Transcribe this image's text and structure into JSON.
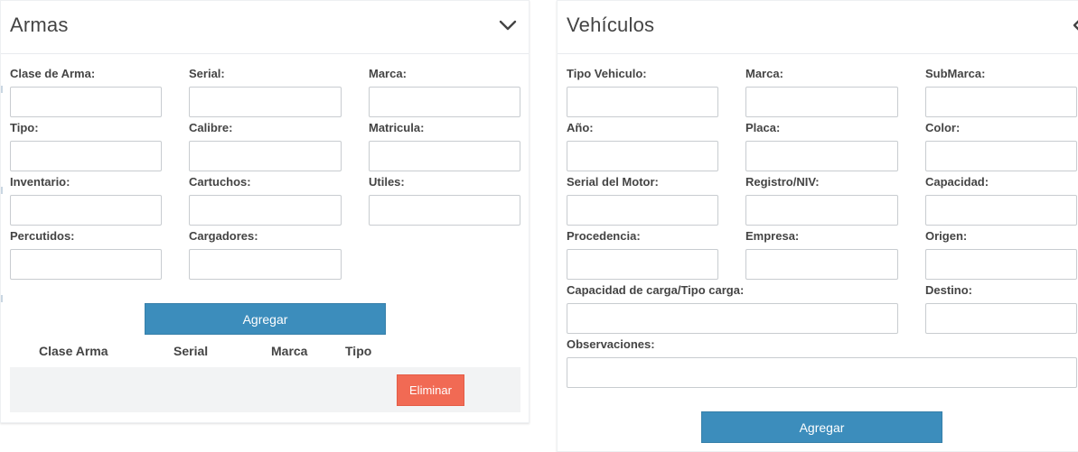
{
  "armas": {
    "title": "Armas",
    "toggle_icon": "chevron-down-icon",
    "fields": {
      "clase_arma": "Clase de Arma:",
      "serial": "Serial:",
      "marca": "Marca:",
      "tipo": "Tipo:",
      "calibre": "Calibre:",
      "matricula": "Matricula:",
      "inventario": "Inventario:",
      "cartuchos": "Cartuchos:",
      "utiles": "Utiles:",
      "percutidos": "Percutidos:",
      "cargadores": "Cargadores:"
    },
    "add_label": "Agregar",
    "table": {
      "headers": [
        "Clase Arma",
        "Serial",
        "Marca",
        "Tipo"
      ],
      "delete_label": "Eliminar"
    }
  },
  "vehiculos": {
    "title": "Vehículos",
    "toggle_icon": "chevron-left-icon",
    "fields": {
      "tipo_vehiculo": "Tipo Vehiculo:",
      "marca": "Marca:",
      "submarca": "SubMarca:",
      "anio": "Año:",
      "placa": "Placa:",
      "color": "Color:",
      "serial_motor": "Serial del Motor:",
      "registro_niv": "Registro/NIV:",
      "capacidad": "Capacidad:",
      "procedencia": "Procedencia:",
      "empresa": "Empresa:",
      "origen": "Origen:",
      "capacidad_carga": "Capacidad de carga/Tipo carga:",
      "destino": "Destino:",
      "observaciones": "Observaciones:"
    },
    "add_label": "Agregar"
  },
  "colors": {
    "primary": "#3c8dbc",
    "danger": "#f16a54",
    "row_bg": "#f2f3f4"
  }
}
